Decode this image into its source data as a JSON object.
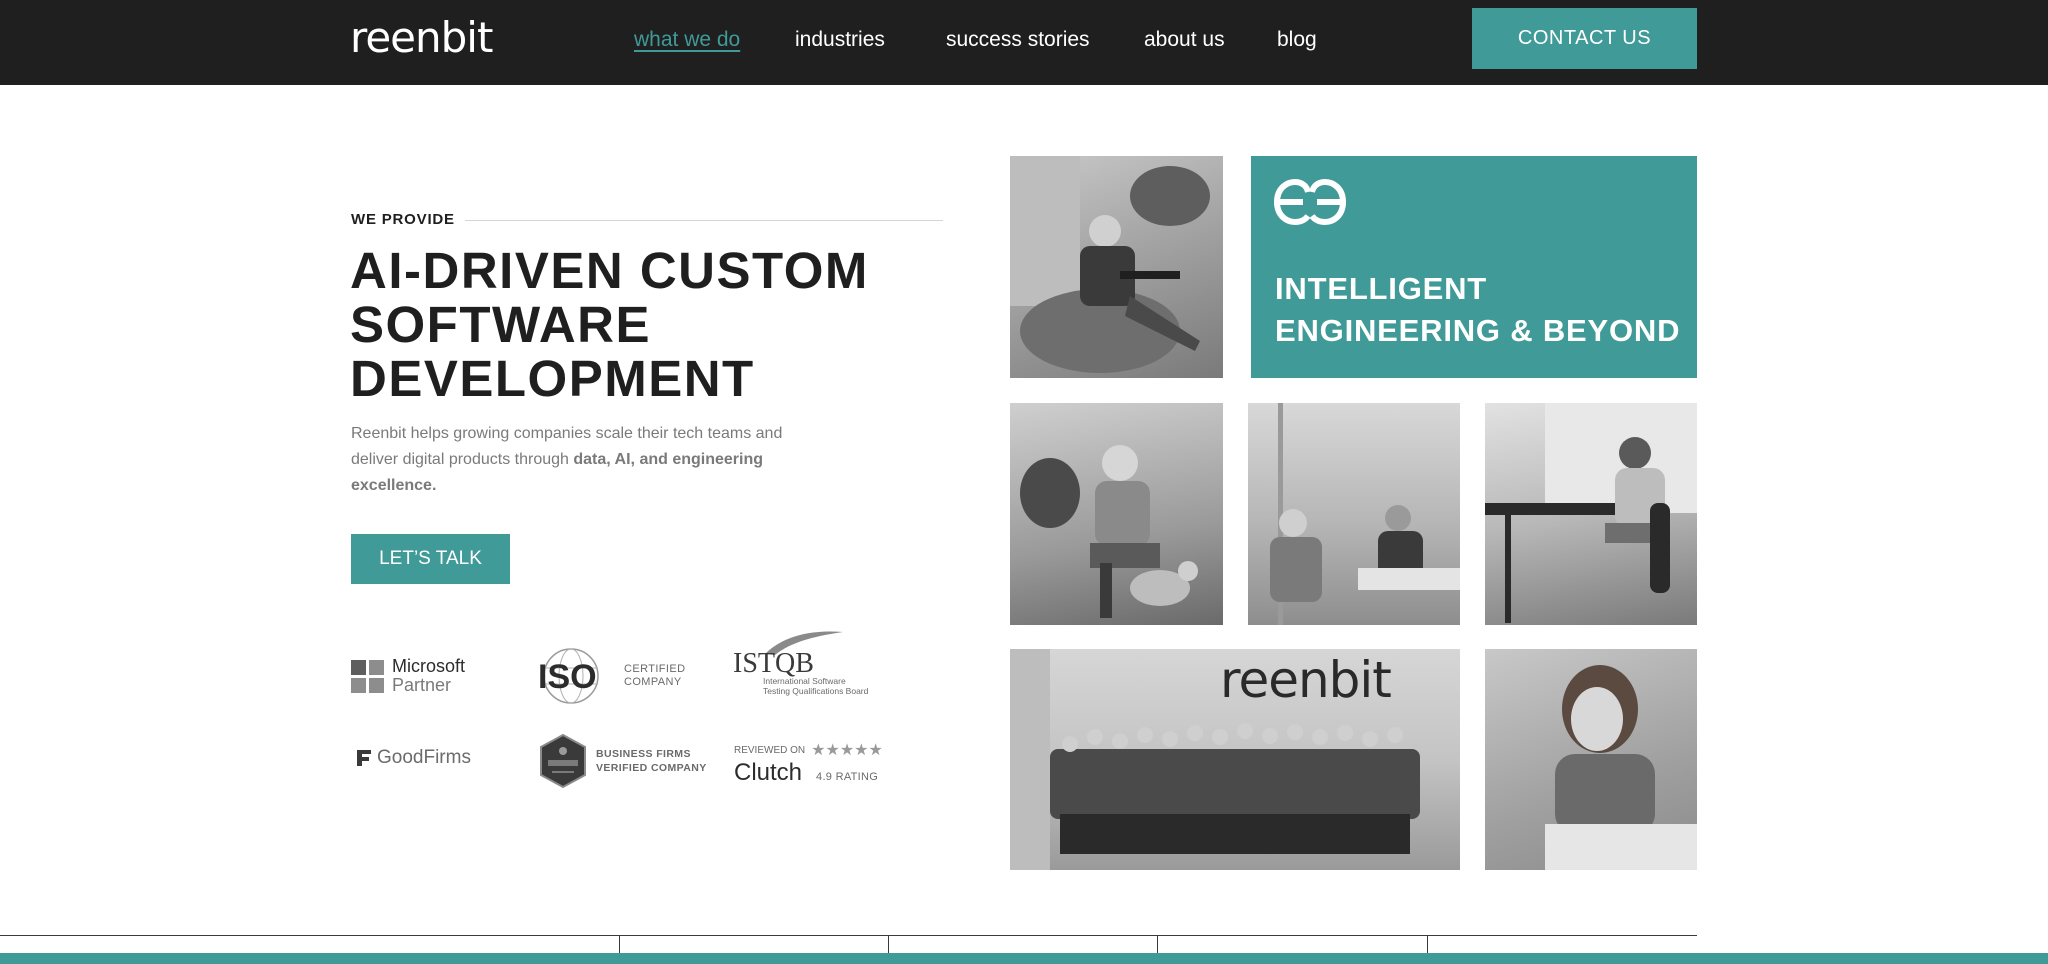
{
  "nav": {
    "logo": "reenbit",
    "links": [
      {
        "label": "what we do",
        "active": true
      },
      {
        "label": "industries",
        "active": false
      },
      {
        "label": "success stories",
        "active": false
      },
      {
        "label": "about us",
        "active": false
      },
      {
        "label": "blog",
        "active": false
      }
    ],
    "contact_label": "CONTACT US"
  },
  "hero": {
    "eyebrow": "WE PROVIDE",
    "headline": [
      "AI-DRIVEN CUSTOM",
      "SOFTWARE",
      "DEVELOPMENT"
    ],
    "lead_plain": "Reenbit helps growing companies scale their tech teams and deliver digital products through ",
    "lead_bold": "data, AI, and engineering excellence.",
    "cta_label": "LET’S TALK"
  },
  "badges": {
    "microsoft": {
      "line1": "Microsoft",
      "line2": "Partner"
    },
    "iso": {
      "mark": "ISO",
      "line1": "CERTIFIED",
      "line2": "COMPANY"
    },
    "istqb": {
      "name": "ISTQB",
      "line1": "International Software",
      "line2": "Testing Qualifications Board"
    },
    "goodfirms": {
      "name": "GoodFirms"
    },
    "businessfirms": {
      "line1": "BUSINESS FIRMS",
      "line2": "VERIFIED COMPANY"
    },
    "clutch": {
      "reviewed": "REVIEWED ON",
      "name": "Clutch",
      "stars": "★★★★★",
      "rating": "4.9 RATING"
    }
  },
  "gallery": {
    "tagline": [
      "INTELLIGENT",
      "ENGINEERING & BEYOND"
    ],
    "group_logo": "reenbit"
  },
  "colors": {
    "accent": "#3f9a98",
    "nav_bg": "#1f1f1f",
    "text": "#1f1f1f",
    "muted": "#7a7a7a"
  }
}
